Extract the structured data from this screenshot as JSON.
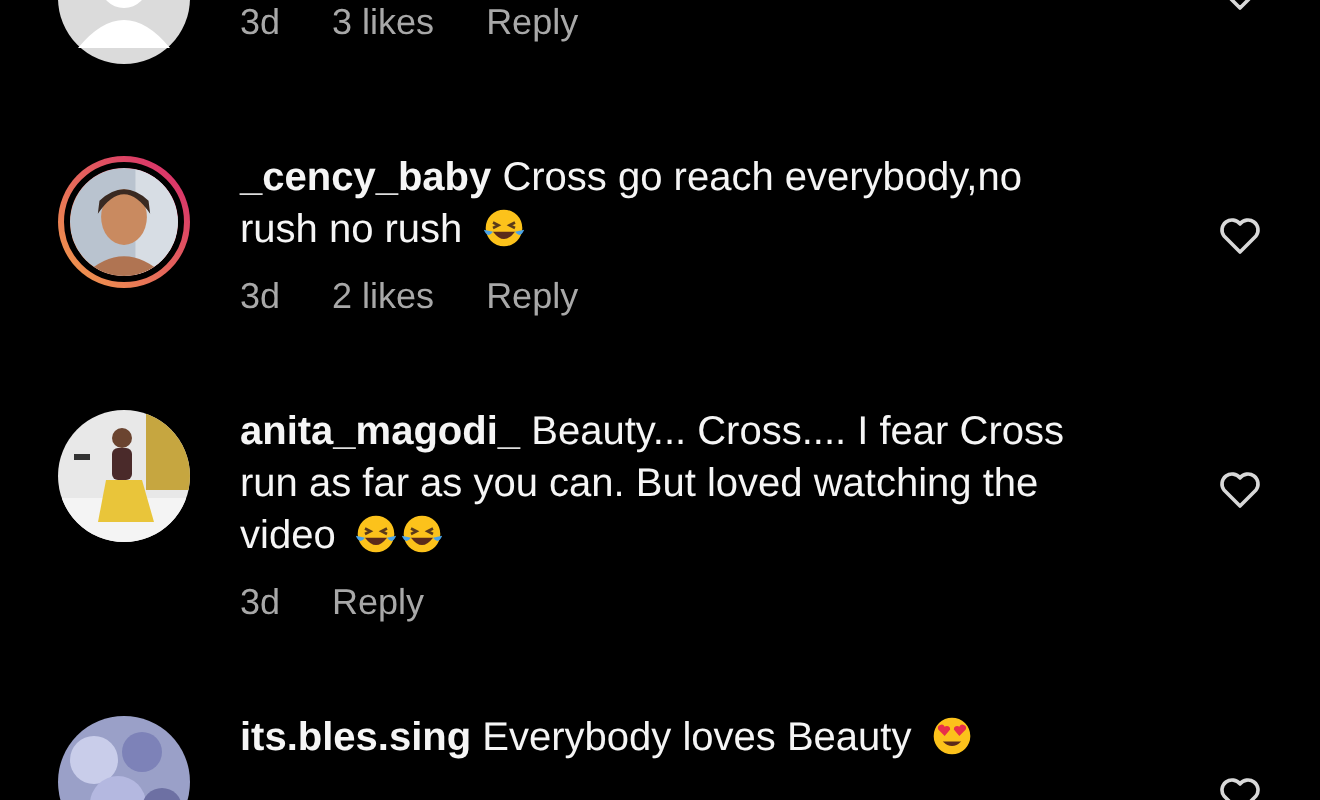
{
  "comments": [
    {
      "avatar": {
        "kind": "default",
        "story_ring": false
      },
      "time": "3d",
      "likes": "3 likes",
      "reply": "Reply",
      "liked": false
    },
    {
      "avatar": {
        "kind": "picture",
        "story_ring": true
      },
      "username": "_cency_baby",
      "text": "Cross go reach everybody,no rush no rush",
      "emojis": [
        {
          "kind": "laughing"
        }
      ],
      "time": "3d",
      "likes": "2 likes",
      "reply": "Reply",
      "liked": false
    },
    {
      "avatar": {
        "kind": "picture",
        "story_ring": false
      },
      "username": "anita_magodi_",
      "text": "Beauty... Cross.... I fear Cross run as far as you can. But loved watching the video",
      "emojis": [
        {
          "kind": "laughing"
        },
        {
          "kind": "laughing"
        }
      ],
      "time": "3d",
      "reply": "Reply",
      "liked": false
    },
    {
      "avatar": {
        "kind": "picture",
        "story_ring": false
      },
      "username": "its.bles.sing",
      "text": "Everybody loves Beauty",
      "emojis": [
        {
          "kind": "heart-eyes"
        }
      ],
      "liked": false
    }
  ]
}
